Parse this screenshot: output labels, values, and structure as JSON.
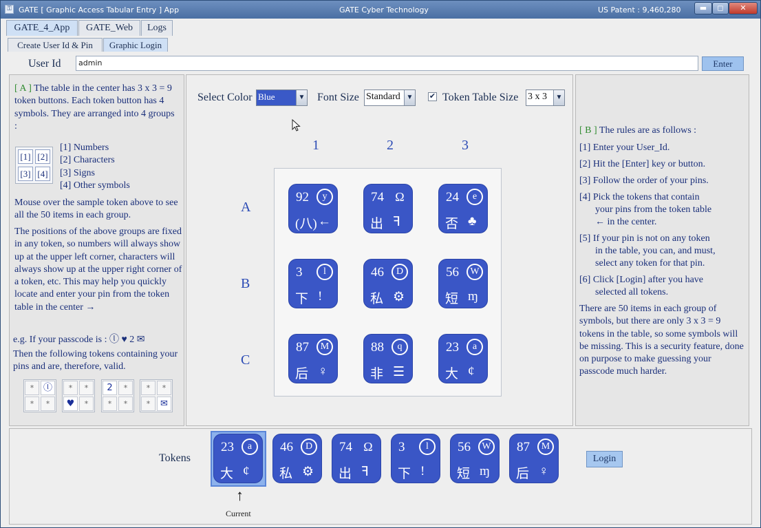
{
  "window": {
    "title": "GATE [ Graphic Access Tabular Entry ] App",
    "center_title": "GATE Cyber Technology",
    "patent": "US Patent : 9,460,280",
    "controls": {
      "minimize": "▬",
      "maximize": "◻",
      "close": "✕"
    }
  },
  "tabs": [
    "GATE_4_App",
    "GATE_Web",
    "Logs"
  ],
  "subtabs": [
    "Create User Id & Pin",
    "Graphic Login"
  ],
  "userid": {
    "label": "User Id",
    "value": "admin",
    "enter_label": "Enter"
  },
  "left": {
    "tag": "[ A ]",
    "intro": "The table in the center has 3 x 3 = 9 token buttons. Each token button has 4 symbols. They are arranged into 4 groups :",
    "groups": [
      "[1] Numbers",
      "[2] Characters",
      "[3] Signs",
      "[4] Other symbols"
    ],
    "sample_cells": [
      "[1]",
      "[2]",
      "[3]",
      "[4]"
    ],
    "mouse_over": "Mouse over the sample token above to see all the 50 items in each group.",
    "positions": "The positions of the above groups are fixed in any token, so numbers will always show up at the upper left corner, characters will always show up at the upper right corner of a token, etc. This may help you quickly locate and enter your pin from the token table in the center →",
    "example": "e.g. If your passcode is : ⓛ ♥ 2 ✉",
    "example2": "Then the following tokens containing your pins and are, therefore, valid.",
    "mini_tokens": [
      [
        "*",
        "ⓛ",
        "*",
        "*"
      ],
      [
        "*",
        "*",
        "♥",
        "*"
      ],
      [
        "2",
        "*",
        "*",
        "*"
      ],
      [
        "*",
        "*",
        "*",
        "✉"
      ]
    ]
  },
  "center": {
    "select_color_label": "Select Color",
    "color_value": "Blue",
    "font_size_label": "Font Size",
    "font_size_value": "Standard",
    "checkbox_mark": "✔",
    "table_size_label": "Token Table Size",
    "table_size_value": "3 x 3",
    "col_heads": [
      "1",
      "2",
      "3"
    ],
    "row_heads": [
      "A",
      "B",
      "C"
    ],
    "tokens": [
      {
        "num": "92",
        "chr": "y",
        "sgn": "(八)",
        "oth": "←",
        "circ": true
      },
      {
        "num": "74",
        "chr": "Ω",
        "sgn": "出",
        "oth": "ꟻ",
        "circ": false
      },
      {
        "num": "24",
        "chr": "e",
        "sgn": "否",
        "oth": "♣",
        "circ": true
      },
      {
        "num": "3",
        "chr": "l",
        "sgn": "下",
        "oth": "!",
        "circ": true
      },
      {
        "num": "46",
        "chr": "D",
        "sgn": "私",
        "oth": "⚙",
        "circ": true
      },
      {
        "num": "56",
        "chr": "W",
        "sgn": "短",
        "oth": "ɱ",
        "circ": true
      },
      {
        "num": "87",
        "chr": "M",
        "sgn": "后",
        "oth": "♀",
        "circ": true
      },
      {
        "num": "88",
        "chr": "q",
        "sgn": "非",
        "oth": "☰",
        "circ": true
      },
      {
        "num": "23",
        "chr": "a",
        "sgn": "大",
        "oth": "¢",
        "circ": true
      }
    ]
  },
  "right": {
    "tag": "[ B ]",
    "title": "The rules are as follows :",
    "rules": [
      "[1] Enter your User_Id.",
      "[2] Hit the [Enter] key or button.",
      "[3] Follow the order of your pins.",
      "[4] Pick the tokens that contain",
      "your pins from the token table",
      "← in the center.",
      "[5] If your pin is not on any token",
      "in the table, you can, and must,",
      "select any token for that pin.",
      "[6] Click [Login] after you have",
      "selected all tokens."
    ],
    "note": "There are 50 items in each group of symbols, but there are only 3 x 3 = 9 tokens in the table, so some symbols will be missing. This is a security feature, done on purpose to make guessing your passcode much harder."
  },
  "bottom": {
    "tokens_label": "Tokens",
    "current_arrow": "↑",
    "current_label": "Current",
    "login_label": "Login",
    "selected": [
      {
        "num": "23",
        "chr": "a",
        "sgn": "大",
        "oth": "¢",
        "circ": true
      },
      {
        "num": "46",
        "chr": "D",
        "sgn": "私",
        "oth": "⚙",
        "circ": true
      },
      {
        "num": "74",
        "chr": "Ω",
        "sgn": "出",
        "oth": "ꟻ",
        "circ": false
      },
      {
        "num": "3",
        "chr": "l",
        "sgn": "下",
        "oth": "!",
        "circ": true
      },
      {
        "num": "56",
        "chr": "W",
        "sgn": "短",
        "oth": "ɱ",
        "circ": true
      },
      {
        "num": "87",
        "chr": "M",
        "sgn": "后",
        "oth": "♀",
        "circ": true
      }
    ]
  }
}
